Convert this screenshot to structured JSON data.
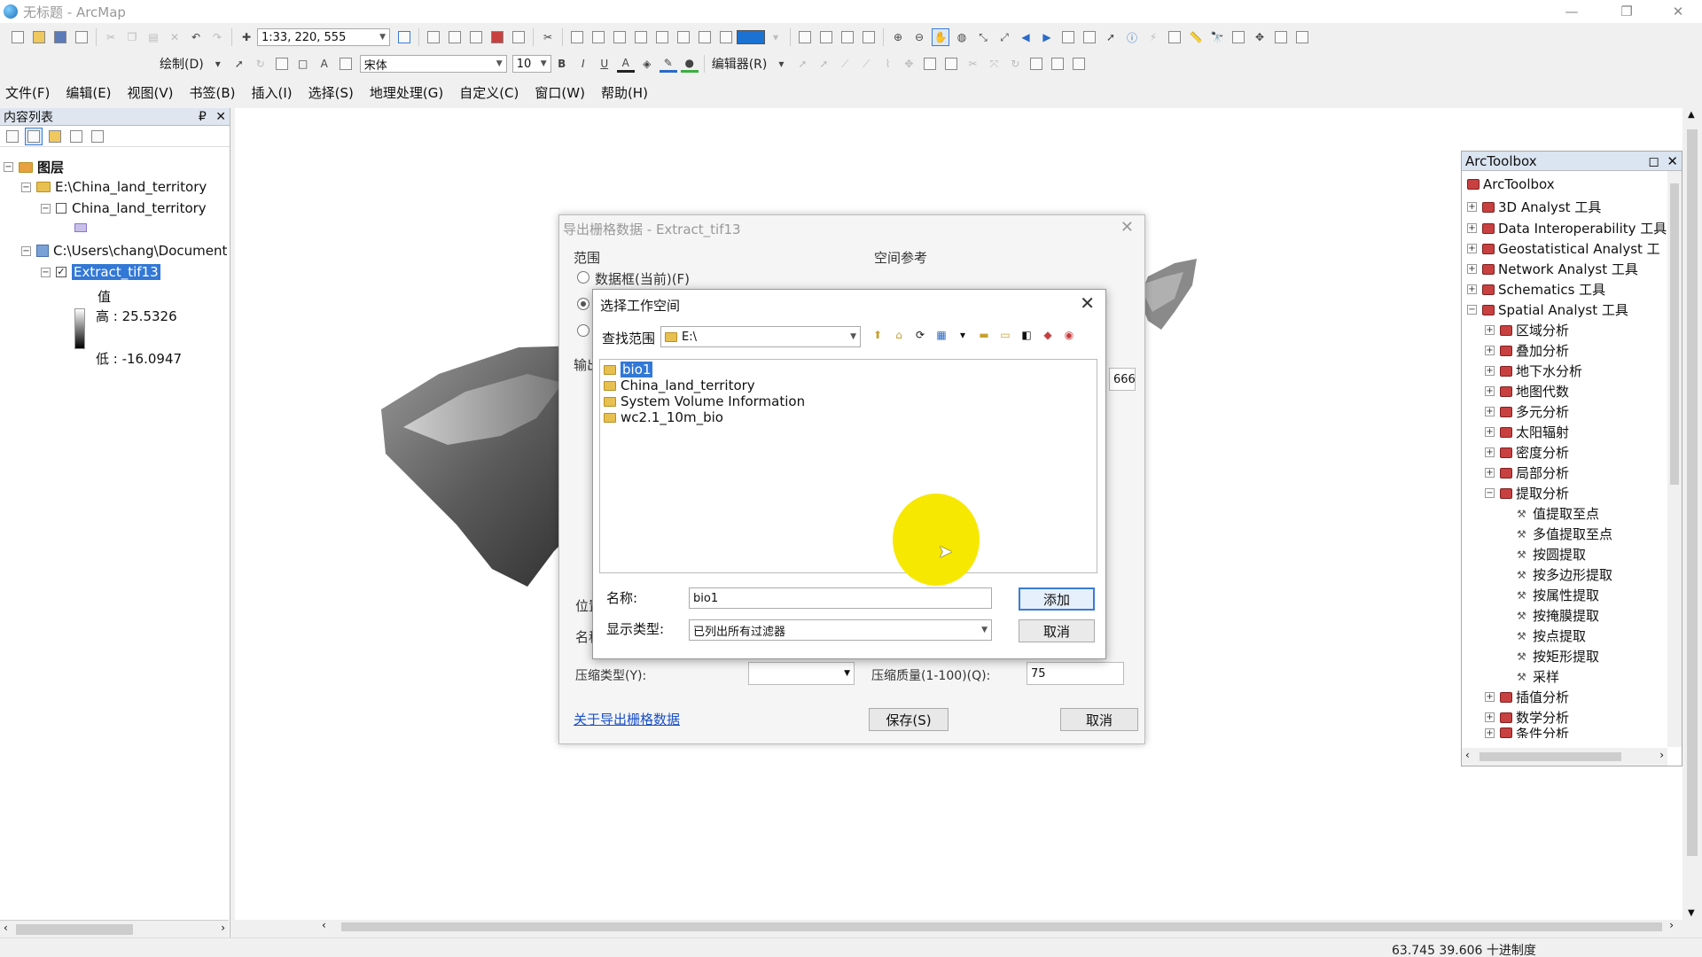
{
  "window": {
    "title": "无标题 - ArcMap",
    "controls": {
      "minimize": "—",
      "maximize": "❐",
      "close": "✕"
    }
  },
  "toolbar1": {
    "scale": "1:33, 220, 555"
  },
  "toolbar2": {
    "draw_label": "绘制(D)",
    "font": "宋体",
    "font_size": "10",
    "bold": "B",
    "italic": "I",
    "underline": "U",
    "font_color": "A",
    "editor_label": "编辑器(R)",
    "accent_color": "#1b72d2"
  },
  "menubar": {
    "items": [
      "文件(F)",
      "编辑(E)",
      "视图(V)",
      "书签(B)",
      "插入(I)",
      "选择(S)",
      "地理处理(G)",
      "自定义(C)",
      "窗口(W)",
      "帮助(H)"
    ]
  },
  "toc": {
    "title": "内容列表",
    "pin": "₽",
    "close": "✕",
    "layers_root": "图层",
    "group1": "E:\\China_land_territory",
    "layer1": "China_land_territory",
    "group2": "C:\\Users\\chang\\Document",
    "layer2": "Extract_tif13",
    "value_label": "值",
    "high": "高 : 25.5326",
    "low": "低 : -16.0947"
  },
  "arctoolbox": {
    "title": "ArcToolbox",
    "root": "ArcToolbox",
    "toolboxes": [
      "3D Analyst 工具",
      "Data Interoperability 工具",
      "Geostatistical Analyst 工",
      "Network Analyst 工具",
      "Schematics 工具",
      "Spatial Analyst 工具"
    ],
    "spatial_children": [
      "区域分析",
      "叠加分析",
      "地下水分析",
      "地图代数",
      "多元分析",
      "太阳辐射",
      "密度分析",
      "局部分析",
      "提取分析"
    ],
    "extract_tools": [
      "值提取至点",
      "多值提取至点",
      "按圆提取",
      "按多边形提取",
      "按属性提取",
      "按掩膜提取",
      "按点提取",
      "按矩形提取",
      "采样"
    ],
    "after": [
      "插值分析",
      "数学分析",
      "条件分析"
    ]
  },
  "export_dialog": {
    "title": "导出栅格数据 - Extract_tif13",
    "extent_label": "范围",
    "radio1": "数据框(当前)(F)",
    "spatial_ref_label": "空间参考",
    "output_label": "输出",
    "location_label": "位置",
    "name_label": "名称",
    "compression_type_label": "压缩类型(Y):",
    "compression_quality_label": "压缩质量(1-100)(Q):",
    "compression_quality_value": "75",
    "field_value": "666",
    "help_link": "关于导出栅格数据",
    "save_button": "保存(S)",
    "cancel_button": "取消"
  },
  "workspace_dialog": {
    "title": "选择工作空间",
    "look_in_label": "查找范围",
    "look_in_value": "E:\\",
    "files": [
      "bio1",
      "China_land_territory",
      "System Volume Information",
      "wc2.1_10m_bio"
    ],
    "selected_file": "bio1",
    "name_label": "名称:",
    "name_value": "bio1",
    "show_type_label": "显示类型:",
    "show_type_value": "已列出所有过滤器",
    "add_button": "添加",
    "cancel_button": "取消"
  },
  "statusbar": {
    "coords": "63.745  39.606 十进制度"
  }
}
